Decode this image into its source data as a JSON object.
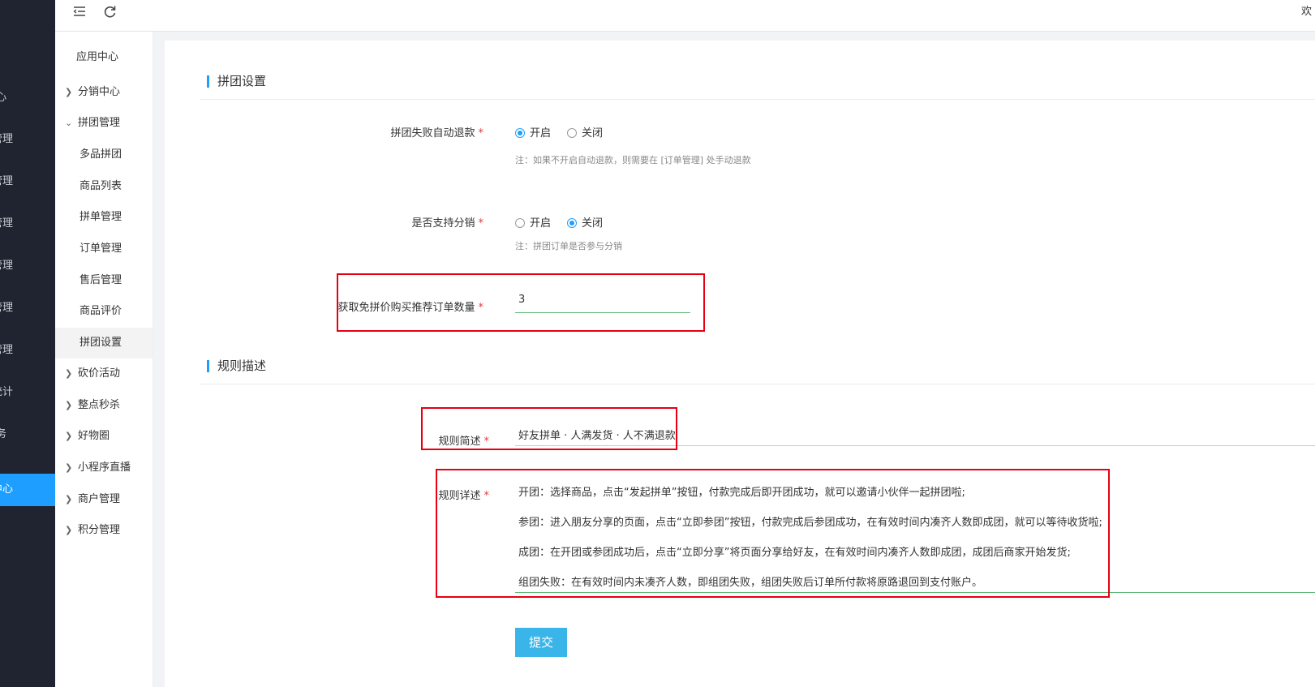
{
  "rail": {
    "items": [
      {
        "label": "心"
      },
      {
        "label": "管理"
      },
      {
        "label": "管理"
      },
      {
        "label": "管理"
      },
      {
        "label": "管理"
      },
      {
        "label": "管理"
      },
      {
        "label": "管理"
      },
      {
        "label": "统计"
      },
      {
        "label": "务"
      },
      {
        "label": "中心"
      }
    ]
  },
  "header": {
    "right_text": "欢"
  },
  "submenu": {
    "title": "应用中心",
    "groups": [
      {
        "label": "分销中心",
        "chevron": ">"
      },
      {
        "label": "拼团管理",
        "chevron": "v"
      },
      {
        "label": "多品拼团"
      },
      {
        "label": "商品列表"
      },
      {
        "label": "拼单管理"
      },
      {
        "label": "订单管理"
      },
      {
        "label": "售后管理"
      },
      {
        "label": "商品评价"
      },
      {
        "label": "拼团设置"
      },
      {
        "label": "砍价活动",
        "chevron": ">"
      },
      {
        "label": "整点秒杀",
        "chevron": ">"
      },
      {
        "label": "好物圈",
        "chevron": ">"
      },
      {
        "label": "小程序直播",
        "chevron": ">"
      },
      {
        "label": "商户管理",
        "chevron": ">"
      },
      {
        "label": "积分管理",
        "chevron": ">"
      }
    ]
  },
  "form": {
    "section1_title": "拼团设置",
    "refund": {
      "label": "拼团失败自动退款",
      "options": [
        "开启",
        "关闭"
      ],
      "selected": "开启",
      "note": "注：如果不开启自动退款，则需要在 [订单管理] 处手动退款"
    },
    "distribution": {
      "label": "是否支持分销",
      "options": [
        "开启",
        "关闭"
      ],
      "selected": "关闭",
      "note": "注：拼团订单是否参与分销"
    },
    "free_orders": {
      "label": "获取免拼价购买推荐订单数量",
      "value": "3"
    },
    "section2_title": "规则描述",
    "rule_brief": {
      "label": "规则简述",
      "value": "好友拼单 · 人满发货 · 人不满退款"
    },
    "rule_detail": {
      "label": "规则详述",
      "lines": [
        "开团：选择商品，点击“发起拼单”按钮，付款完成后即开团成功，就可以邀请小伙伴一起拼团啦;",
        "参团：进入朋友分享的页面，点击“立即参团”按钮，付款完成后参团成功，在有效时间内凑齐人数即成团，就可以等待收货啦;",
        "成团：在开团或参团成功后，点击“立即分享”将页面分享给好友，在有效时间内凑齐人数即成团，成团后商家开始发货;",
        "组团失败：在有效时间内未凑齐人数，即组团失败，组团失败后订单所付款将原路退回到支付账户。"
      ]
    },
    "submit_label": "提交",
    "required_mark": "*"
  }
}
